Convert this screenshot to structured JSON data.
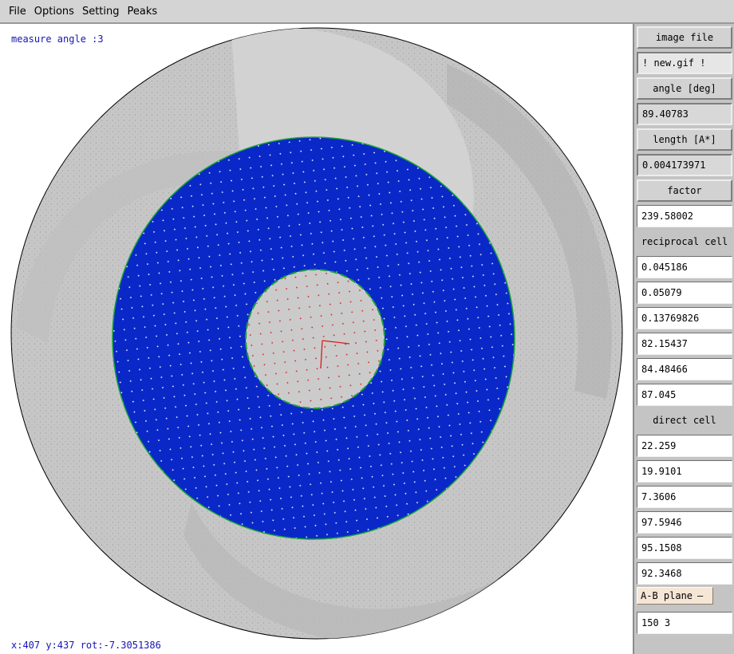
{
  "menubar": {
    "items": [
      "File",
      "Options",
      "Setting",
      "Peaks"
    ]
  },
  "canvas": {
    "mode_text": "measure angle :3",
    "status_text": "x:407 y:437  rot:-7.3051386"
  },
  "panel": {
    "image_file_label": "image file",
    "image_file_value": "! new.gif !",
    "angle_label": "angle [deg]",
    "angle_value": "89.40783",
    "length_label": "length [A*]",
    "length_value": "0.004173971",
    "factor_label": "factor",
    "factor_value": "239.58002",
    "reciprocal_label": "reciprocal cell",
    "reciprocal_values": [
      "0.045186",
      "0.05079",
      "0.13769826",
      "82.15437",
      "84.48466",
      "87.045"
    ],
    "direct_label": "direct cell",
    "direct_values": [
      "22.259",
      "19.9101",
      "7.3606",
      "97.5946",
      "95.1508",
      "92.3468"
    ],
    "plane_label": "A-B  plane",
    "plane_icon": "dropdown-indicator-icon",
    "bottom_value": "150 3"
  },
  "colors": {
    "disc_blue": "#0a28c8",
    "disc_edge": "#18a03c",
    "grey_bg": "#cbcbcb",
    "marker_red": "#e01818",
    "overlay_text": "#1414b4"
  }
}
